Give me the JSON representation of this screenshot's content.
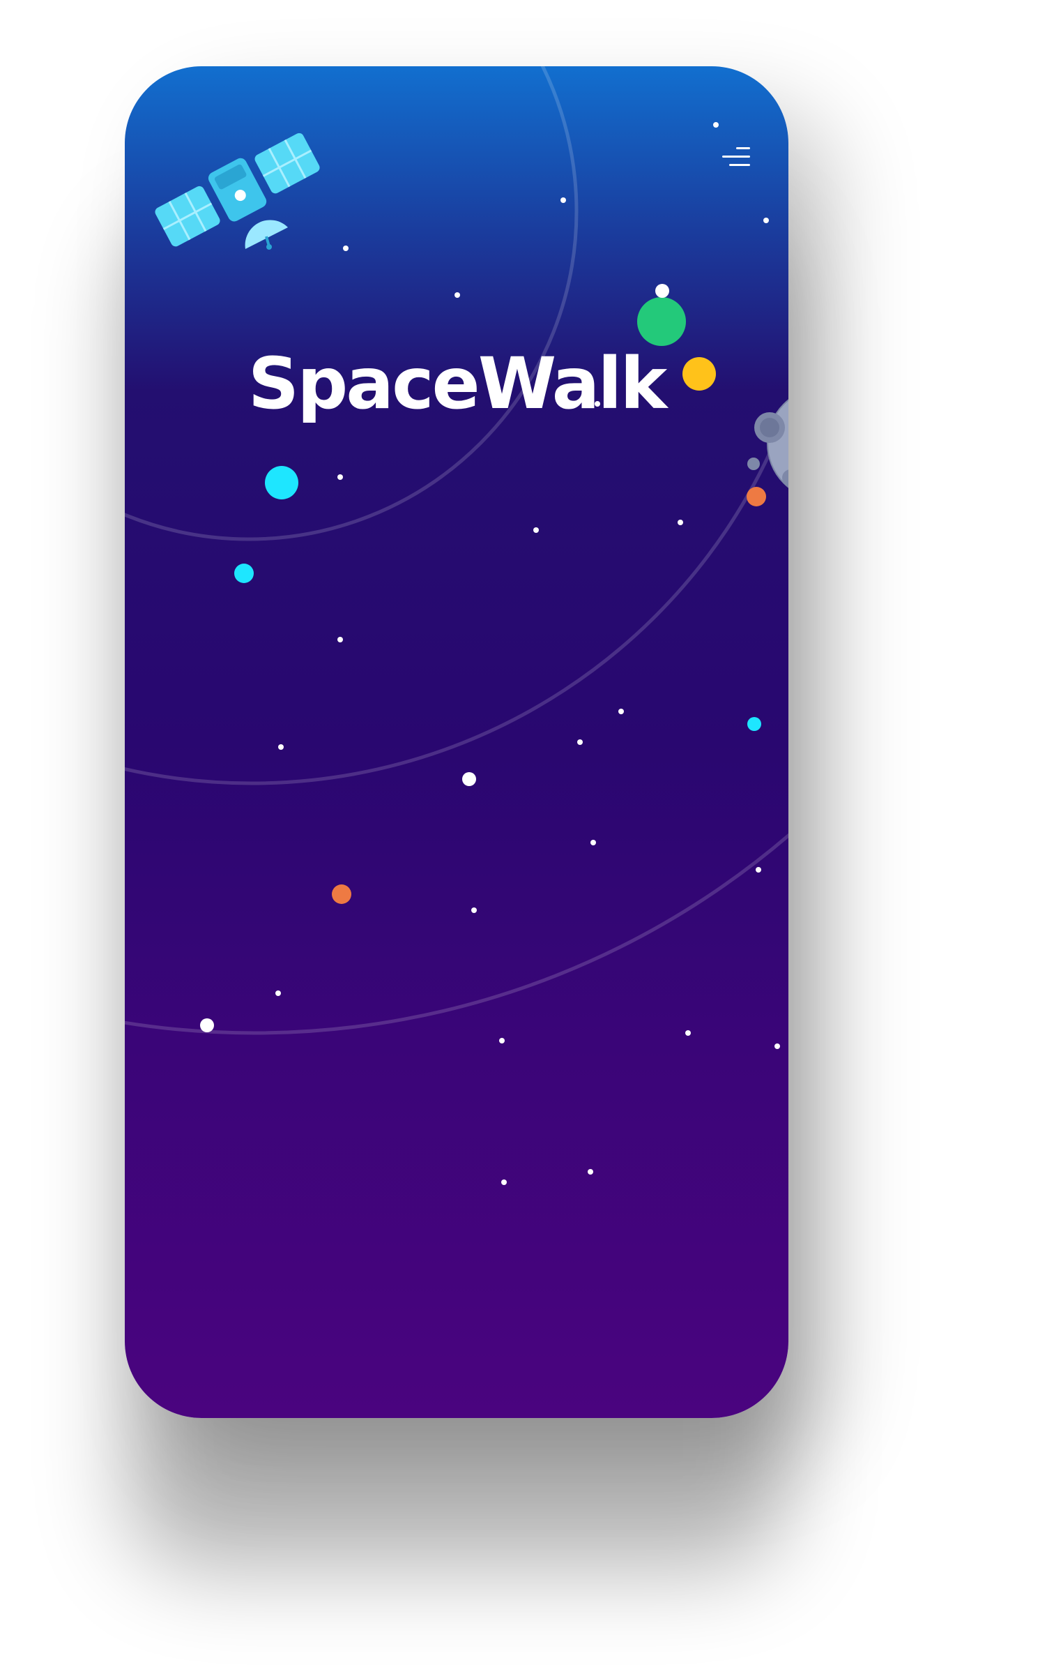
{
  "app": {
    "title": "SpaceWalk"
  },
  "header": {
    "menu_icon": "hamburger-menu-icon"
  },
  "illustration": {
    "icons": [
      "satellite-icon",
      "moon-icon",
      "planet-icon"
    ]
  },
  "colors": {
    "gradient_top": "#126fcf",
    "gradient_mid": "#290770",
    "gradient_bottom": "#4a047f",
    "cyan": "#1ee6ff",
    "green": "#23c97a",
    "yellow": "#ffc21a",
    "orange": "#ee7a43",
    "moon": "#9aa4c0"
  }
}
